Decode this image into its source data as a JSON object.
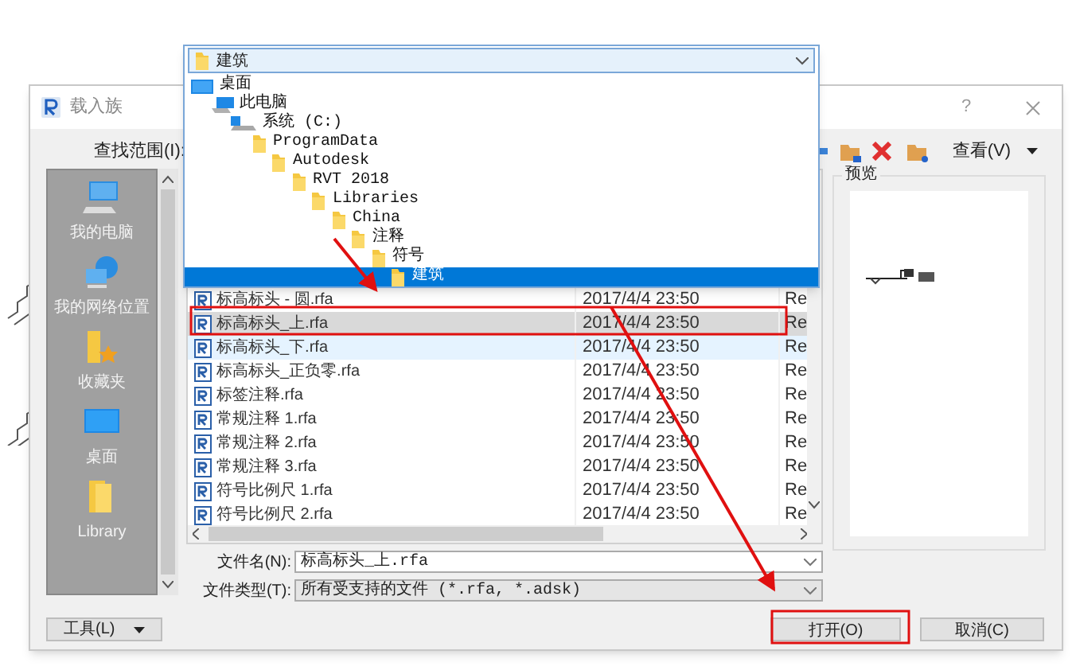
{
  "window": {
    "title": "载入族",
    "help": "?"
  },
  "look_in": {
    "label": "查找范围(I):",
    "dropdown": {
      "value": "建筑",
      "expanded": true,
      "tree": [
        {
          "label": "桌面",
          "kind": "desktop",
          "selected": false,
          "children": [
            {
              "label": "此电脑",
              "kind": "computer",
              "selected": false,
              "children": [
                {
                  "label": "系统 (C:)",
                  "kind": "drive",
                  "selected": false,
                  "children": [
                    {
                      "label": "ProgramData",
                      "kind": "folder",
                      "selected": false,
                      "children": [
                        {
                          "label": "Autodesk",
                          "kind": "folder",
                          "selected": false,
                          "children": [
                            {
                              "label": "RVT 2018",
                              "kind": "folder",
                              "selected": false,
                              "children": [
                                {
                                  "label": "Libraries",
                                  "kind": "folder",
                                  "selected": false,
                                  "children": [
                                    {
                                      "label": "China",
                                      "kind": "folder",
                                      "selected": false,
                                      "children": [
                                        {
                                          "label": "注释",
                                          "kind": "folder",
                                          "selected": false,
                                          "children": [
                                            {
                                              "label": "符号",
                                              "kind": "folder",
                                              "selected": false,
                                              "children": [
                                                {
                                                  "label": "建筑",
                                                  "kind": "folder",
                                                  "selected": true
                                                }
                                              ]
                                            }
                                          ]
                                        }
                                      ]
                                    }
                                  ]
                                }
                              ]
                            }
                          ]
                        }
                      ]
                    }
                  ]
                }
              ]
            }
          ]
        }
      ]
    }
  },
  "view_menu": "查看(V)",
  "places": [
    {
      "label": "我的电脑",
      "kind": "computer"
    },
    {
      "label": "我的网络位置",
      "kind": "network"
    },
    {
      "label": "收藏夹",
      "kind": "favorites"
    },
    {
      "label": "桌面",
      "kind": "desktop"
    },
    {
      "label": "Library",
      "kind": "folder"
    }
  ],
  "files": [
    {
      "name": "标高标头 - 圆.rfa",
      "modified": "2017/4/4 23:50",
      "type": "Re",
      "selected": false,
      "hovered": false
    },
    {
      "name": "标高标头_上.rfa",
      "modified": "2017/4/4 23:50",
      "type": "Re",
      "selected": true,
      "hovered": false
    },
    {
      "name": "标高标头_下.rfa",
      "modified": "2017/4/4 23:50",
      "type": "Re",
      "selected": false,
      "hovered": true
    },
    {
      "name": "标高标头_正负零.rfa",
      "modified": "2017/4/4 23:50",
      "type": "Re",
      "selected": false,
      "hovered": false
    },
    {
      "name": "标签注释.rfa",
      "modified": "2017/4/4 23:50",
      "type": "Re",
      "selected": false,
      "hovered": false
    },
    {
      "name": "常规注释 1.rfa",
      "modified": "2017/4/4 23:50",
      "type": "Re",
      "selected": false,
      "hovered": false
    },
    {
      "name": "常规注释 2.rfa",
      "modified": "2017/4/4 23:50",
      "type": "Re",
      "selected": false,
      "hovered": false
    },
    {
      "name": "常规注释 3.rfa",
      "modified": "2017/4/4 23:50",
      "type": "Re",
      "selected": false,
      "hovered": false
    },
    {
      "name": "符号比例尺 1.rfa",
      "modified": "2017/4/4 23:50",
      "type": "Re",
      "selected": false,
      "hovered": false
    },
    {
      "name": "符号比例尺 2.rfa",
      "modified": "2017/4/4 23:50",
      "type": "Re",
      "selected": false,
      "hovered": false
    }
  ],
  "preview": {
    "label": "预览"
  },
  "file_name": {
    "label": "文件名(N):",
    "value": "标高标头_上.rfa"
  },
  "file_type": {
    "label": "文件类型(T):",
    "value": "所有受支持的文件 (*.rfa, *.adsk)"
  },
  "buttons": {
    "tools": "工具(L)",
    "open": "打开(O)",
    "cancel": "取消(C)"
  }
}
